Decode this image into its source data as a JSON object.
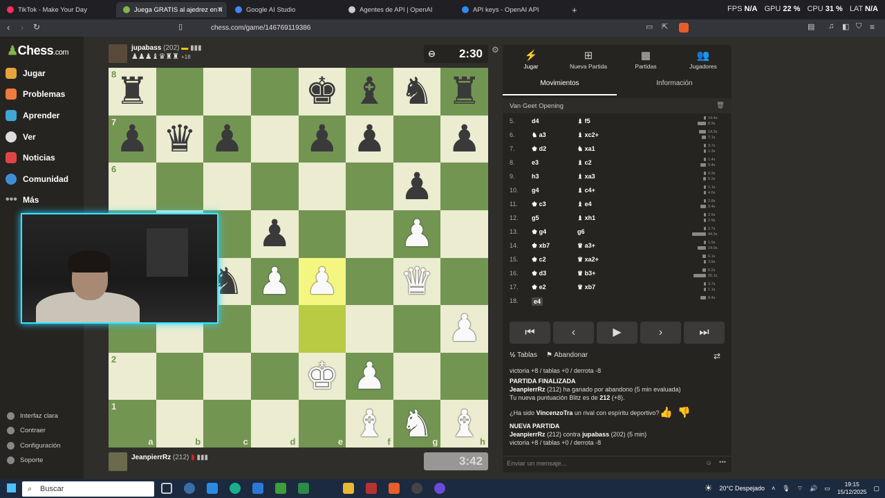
{
  "browser": {
    "tabs": [
      {
        "label": "TikTok - Make Your Day",
        "color": "#ff2e55"
      },
      {
        "label": "Juega GRATIS al ajedrez en lí",
        "color": "#81b64c"
      },
      {
        "label": "Google AI Studio",
        "color": "#4285f4"
      },
      {
        "label": "Agentes de API | OpenAI",
        "color": "#cccccc"
      },
      {
        "label": "API keys - OpenAI API",
        "color": "#2f8cf3"
      }
    ],
    "new_tab": "+",
    "url": "chess.com/game/146769119386",
    "perf": {
      "fps_label": "FPS",
      "fps": "N/A",
      "gpu_label": "GPU",
      "gpu": "22 %",
      "cpu_label": "CPU",
      "cpu": "31 %",
      "lat_label": "LAT",
      "lat": "N/A"
    }
  },
  "sidebar": {
    "logo_text": "Chess",
    "logo_suffix": ".com",
    "items": [
      {
        "label": "Jugar",
        "color": "#e8a33c"
      },
      {
        "label": "Problemas",
        "color": "#f07b3f"
      },
      {
        "label": "Aprender",
        "color": "#3fa7d6"
      },
      {
        "label": "Ver",
        "color": "#dddddd"
      },
      {
        "label": "Noticias",
        "color": "#e04545"
      },
      {
        "label": "Comunidad",
        "color": "#3f8fd6"
      },
      {
        "label": "Más",
        "color": "#aaaaaa"
      }
    ],
    "footer": [
      {
        "label": "Interfaz clara"
      },
      {
        "label": "Contraer"
      },
      {
        "label": "Configuración"
      },
      {
        "label": "Soporte"
      }
    ]
  },
  "top_player": {
    "name": "jupabass",
    "rating": "(202)",
    "captured_extra": "+18",
    "clock": "2:30"
  },
  "bottom_player": {
    "name": "JeanpierrRz",
    "rating": "(212)",
    "clock": "3:42"
  },
  "board": {
    "ranks": [
      "8",
      "7",
      "6",
      "5",
      "4",
      "3",
      "2",
      "1"
    ],
    "files": [
      "a",
      "b",
      "c",
      "d",
      "e",
      "f",
      "g",
      "h"
    ],
    "rows": [
      [
        "r",
        "",
        "",
        "",
        "k",
        "b",
        "n",
        "r"
      ],
      [
        "p",
        "q",
        "p",
        "",
        "p",
        "p",
        "",
        "p"
      ],
      [
        "",
        "",
        "",
        "",
        "",
        "",
        "p",
        ""
      ],
      [
        "",
        "",
        "",
        "p",
        "",
        "",
        "P",
        ""
      ],
      [
        "",
        "",
        "n",
        "P",
        "P",
        "",
        "Q",
        ""
      ],
      [
        "",
        "",
        "",
        "",
        "",
        "",
        "",
        "P"
      ],
      [
        "",
        "",
        "",
        "",
        "K",
        "P",
        "",
        ""
      ],
      [
        "",
        "",
        "",
        "",
        "",
        "B",
        "N",
        "B"
      ]
    ],
    "highlight": [
      "e4",
      "e3"
    ],
    "rank_labels_shown": [
      "8",
      "7",
      "6",
      "2",
      "1"
    ]
  },
  "panel": {
    "tabs": [
      {
        "label": "Jugar",
        "icon": "bolt-icon"
      },
      {
        "label": "Nueva Partida",
        "icon": "plus-icon"
      },
      {
        "label": "Partidas",
        "icon": "board-icon"
      },
      {
        "label": "Jugadores",
        "icon": "people-icon"
      }
    ],
    "subtabs": [
      "Movimientos",
      "Información"
    ],
    "opening": "Van Geet Opening",
    "moves": [
      {
        "n": "5.",
        "w": "d4",
        "b": "♝ f5",
        "tw": 0.1,
        "tb": 0.6,
        "lw": "14.4s",
        "lb": "8.3s"
      },
      {
        "n": "6.",
        "w": "♞ a3",
        "b": "♝ xc2+",
        "tw": 0.5,
        "tb": 0.3,
        "lw": "14.3s",
        "lb": "7.1s"
      },
      {
        "n": "7.",
        "w": "♚ d2",
        "b": "♞ xa1",
        "tw": 0.15,
        "tb": 0.05,
        "lw": "3.7s",
        "lb": "1.3s"
      },
      {
        "n": "8.",
        "w": "e3",
        "b": "♝ c2",
        "tw": 0.06,
        "tb": 0.4,
        "lw": "1.4s",
        "lb": "9.4s"
      },
      {
        "n": "9.",
        "w": "h3",
        "b": "♝ xa3",
        "tw": 0.02,
        "tb": 0.22,
        "lw": "0.3s",
        "lb": "5.2s"
      },
      {
        "n": "10.",
        "w": "g4",
        "b": "♝ c4+",
        "tw": 0.05,
        "tb": 0.17,
        "lw": "1.1s",
        "lb": "4.0s"
      },
      {
        "n": "11.",
        "w": "♚ c3",
        "b": "♝ e4",
        "tw": 0.12,
        "tb": 0.4,
        "lw": "2.8s",
        "lb": "9.4s"
      },
      {
        "n": "12.",
        "w": "g5",
        "b": "♝ xh1",
        "tw": 0.11,
        "tb": 0.12,
        "lw": "2.6s",
        "lb": "2.9s"
      },
      {
        "n": "13.",
        "w": "♚ g4",
        "b": "g6",
        "tw": 0.12,
        "tb": 1.0,
        "lw": "2.7s",
        "lb": "44.3s"
      },
      {
        "n": "14.",
        "w": "♚ xb7",
        "b": "♛ a3+",
        "tw": 0.07,
        "tb": 0.6,
        "lw": "1.5s",
        "lb": "14.0s"
      },
      {
        "n": "15.",
        "w": "♚ c2",
        "b": "♛ xa2+",
        "tw": 0.27,
        "tb": 0.17,
        "lw": "6.1s",
        "lb": "3.9s"
      },
      {
        "n": "16.",
        "w": "♚ d3",
        "b": "♛ b3+",
        "tw": 0.27,
        "tb": 0.9,
        "lw": "6.2s",
        "lb": "20.1s"
      },
      {
        "n": "17.",
        "w": "♚ e2",
        "b": "♛ xb7",
        "tw": 0.17,
        "tb": 0.05,
        "lw": "3.7s",
        "lb": "1.1s"
      },
      {
        "n": "18.",
        "w": "e4",
        "b": "",
        "tw": 0.38,
        "tb": 0,
        "lw": "8.4s",
        "lb": ""
      }
    ],
    "draw_label": "Tablas",
    "resign_label": "Abandonar",
    "chat": {
      "line1": "victoria +8 / tablas +0 / derrota -8",
      "title1": "PARTIDA FINALIZADA",
      "winner": "JeanpierrRz",
      "line2_rest": " (212) ha ganado por abandono (5 min evaluada)",
      "line3_pre": "Tu nueva puntuación Blitz es de ",
      "line3_val": "212",
      "line3_post": " (+8).",
      "q_pre": "¿Ha sido ",
      "q_name": "VincenzoTra",
      "q_post": " un rival con espíritu deportivo?",
      "title2": "NUEVA PARTIDA",
      "np_name": "JeanpierrRz",
      "np_mid": " (212) contra ",
      "np_opp": "jupabass",
      "np_post": " (202) (5 min)",
      "line4": "victoria +8 / tablas +0 / derrota -8"
    },
    "message_placeholder": "Enviar un mensaje..."
  },
  "taskbar": {
    "search": "Buscar",
    "weather": "20°C Despejado",
    "time": "19:15",
    "date": "15/12/2025"
  }
}
